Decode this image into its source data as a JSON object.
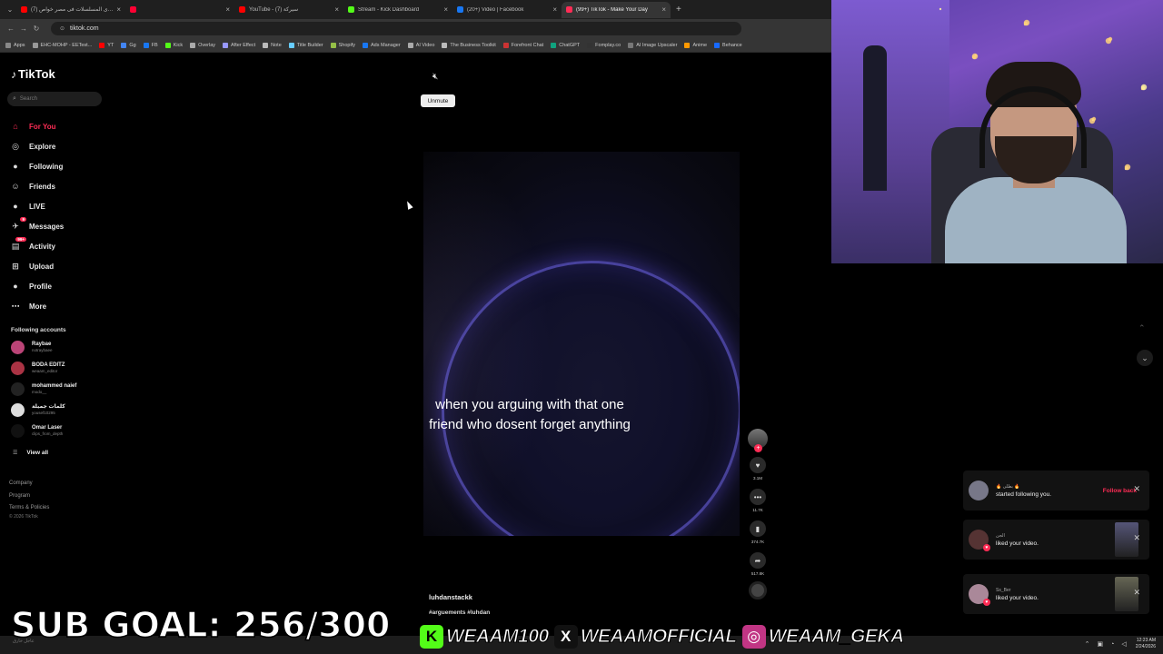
{
  "browser": {
    "tabs": [
      {
        "title": "اقوى المسلسلات فى مصر خواص (7)",
        "color": "#ff0000",
        "active": false
      },
      {
        "title": "",
        "color": "#ff0033",
        "active": false
      },
      {
        "title": "YouTube - سيركة (7)",
        "color": "#ff0000",
        "active": false
      },
      {
        "title": "Stream - Kick Dashboard",
        "color": "#53fc18",
        "active": false
      },
      {
        "title": "(20+) Video | Facebook",
        "color": "#1877f2",
        "active": false
      },
      {
        "title": "(99+) TikTok - Make Your Day",
        "color": "#fe2c55",
        "active": true
      }
    ],
    "url": "tiktok.com",
    "bookmarks": [
      {
        "label": "Apps",
        "color": "#888"
      },
      {
        "label": "EHC-MOHP - EETest...",
        "color": "#999"
      },
      {
        "label": "YT",
        "color": "#ff0000"
      },
      {
        "label": "Gg",
        "color": "#4285f4"
      },
      {
        "label": "FB",
        "color": "#1877f2"
      },
      {
        "label": "Kick",
        "color": "#53fc18"
      },
      {
        "label": "Overlay",
        "color": "#aaa"
      },
      {
        "label": "After Effect",
        "color": "#9999ff"
      },
      {
        "label": "Note",
        "color": "#bbb"
      },
      {
        "label": "Title Builder",
        "color": "#6cf"
      },
      {
        "label": "Shopify",
        "color": "#95bf47"
      },
      {
        "label": "Ads Manager",
        "color": "#1877f2"
      },
      {
        "label": "AI Video",
        "color": "#aaa"
      },
      {
        "label": "The Business Toolkit",
        "color": "#bbb"
      },
      {
        "label": "Forefront Chat",
        "color": "#c33"
      },
      {
        "label": "ChatGPT",
        "color": "#10a37f"
      },
      {
        "label": "Fomplay.co",
        "color": "#333"
      },
      {
        "label": "AI Image Upscaler",
        "color": "#777"
      },
      {
        "label": "Anime",
        "color": "#f90"
      },
      {
        "label": "Behance",
        "color": "#1769ff"
      }
    ]
  },
  "tiktok": {
    "logo": "TikTok",
    "search_placeholder": "Search",
    "nav": [
      {
        "label": "For You",
        "icon": "home-icon",
        "glyph": "⌂",
        "active": true,
        "badge": ""
      },
      {
        "label": "Explore",
        "icon": "compass-icon",
        "glyph": "◎",
        "active": false,
        "badge": ""
      },
      {
        "label": "Following",
        "icon": "following-avatar",
        "glyph": "●",
        "active": false,
        "badge": ""
      },
      {
        "label": "Friends",
        "icon": "friends-icon",
        "glyph": "☺",
        "active": false,
        "badge": ""
      },
      {
        "label": "LIVE",
        "icon": "live-icon",
        "glyph": "●",
        "active": false,
        "badge": ""
      },
      {
        "label": "Messages",
        "icon": "messages-icon",
        "glyph": "✈",
        "active": false,
        "badge": "9"
      },
      {
        "label": "Activity",
        "icon": "activity-icon",
        "glyph": "▤",
        "active": false,
        "badge": "99+"
      },
      {
        "label": "Upload",
        "icon": "upload-icon",
        "glyph": "⊞",
        "active": false,
        "badge": ""
      },
      {
        "label": "Profile",
        "icon": "profile-avatar",
        "glyph": "●",
        "active": false,
        "badge": ""
      },
      {
        "label": "More",
        "icon": "more-icon",
        "glyph": "⋯",
        "active": false,
        "badge": ""
      }
    ],
    "following_title": "Following accounts",
    "following": [
      {
        "name": "Raybae",
        "handle": "notraybaee",
        "color": "#b47"
      },
      {
        "name": "BODA EDITZ",
        "handle": "weaam_editor",
        "color": "#a34"
      },
      {
        "name": "mohammed naief",
        "handle": "modo__",
        "color": "#222"
      },
      {
        "name": "كلمات جميلة",
        "handle": "yousef10295",
        "color": "#ddd"
      },
      {
        "name": "Omar Laser",
        "handle": "clips_from_depth",
        "color": "#111"
      }
    ],
    "view_all": "View all",
    "footer_links": [
      "Company",
      "Program",
      "Terms & Policies"
    ],
    "copyright": "© 2026 TikTok",
    "unmute_tooltip": "Unmute",
    "video_caption": "when you arguing with that one friend who dosent forget anything",
    "actions": [
      {
        "icon": "heart-icon",
        "glyph": "♥",
        "count": "3.1M"
      },
      {
        "icon": "comment-icon",
        "glyph": "•••",
        "count": "11.7K"
      },
      {
        "icon": "bookmark-icon",
        "glyph": "▮",
        "count": "374.7K"
      },
      {
        "icon": "share-icon",
        "glyph": "➦",
        "count": "517.8K"
      }
    ],
    "author": "luhdanstackk",
    "hashtags": "#arguements #luhdan"
  },
  "notifications": [
    {
      "name": "🔥 بطلى 🔥",
      "message": "started following you.",
      "action": "Follow back",
      "avatar": "#778",
      "has_thumb": false
    },
    {
      "name": "الجن",
      "message": "liked your video.",
      "action": "",
      "avatar": "#533",
      "has_thumb": true,
      "thumb": "#557"
    },
    {
      "name": "Ss_Ber",
      "message": "liked your video.",
      "action": "",
      "avatar": "#a89",
      "has_thumb": true,
      "thumb": "#665"
    }
  ],
  "overlay": {
    "sub_goal": "SUB GOAL: 256/300",
    "socials": [
      {
        "icon": "kick-icon",
        "glyph": "K",
        "bg": "#53fc18",
        "fg": "#000",
        "handle": "WEAAM100"
      },
      {
        "icon": "x-icon",
        "glyph": "X",
        "bg": "#111",
        "fg": "#fff",
        "handle": "WEAAMOFFICIAL"
      },
      {
        "icon": "instagram-icon",
        "glyph": "◎",
        "bg": "#c13584",
        "fg": "#fff",
        "handle": "WEAAM_GEKA"
      }
    ]
  },
  "taskbar": {
    "time": "12:23 AM",
    "date": "2/24/2026",
    "lang_hint": "عاجل خارق"
  }
}
